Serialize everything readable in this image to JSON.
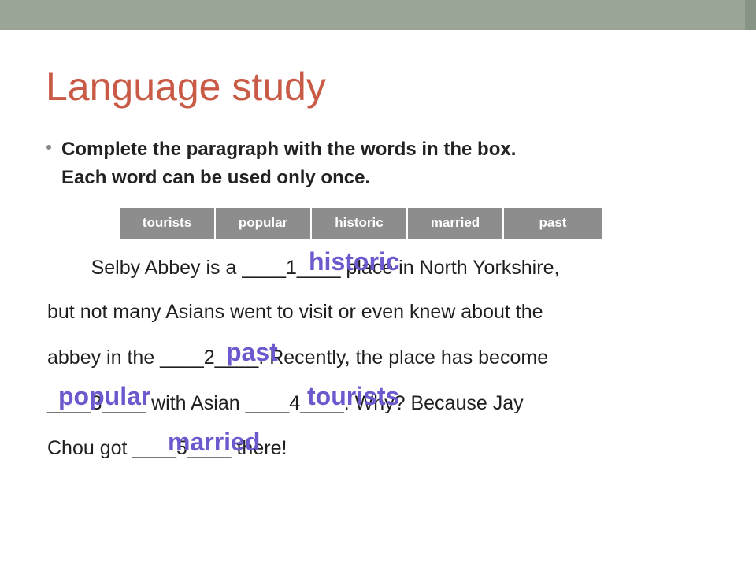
{
  "slide": {
    "title": "Language study",
    "instruction_line1": "Complete the paragraph with the words in the box.",
    "instruction_line2": "Each word can be used only once."
  },
  "word_box": [
    "tourists",
    "popular",
    "historic",
    "married",
    "past"
  ],
  "paragraph": {
    "line1": "        Selby Abbey is a ____1____ place in North Yorkshire,",
    "line2": "but not many Asians went to visit or even knew about the",
    "line3": "abbey in the ____2____. Recently, the place has become",
    "line4": "____3____ with Asian ____4____. Why? Because Jay",
    "line5": "Chou got ____5____ there!"
  },
  "answers": {
    "a1": "historic",
    "a2": "past",
    "a3": "popular",
    "a4": "tourists",
    "a5": "married"
  },
  "colors": {
    "title": "#c85a46",
    "answer": "#6a5acd",
    "top_bar": "#9aa598",
    "word_box": "#8d8d8d"
  }
}
